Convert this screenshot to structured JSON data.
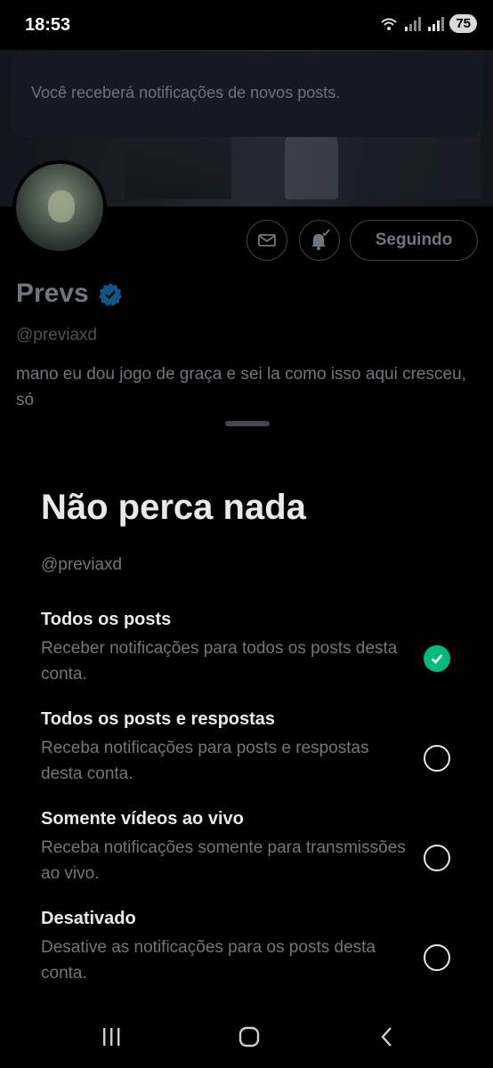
{
  "status_bar": {
    "time": "18:53",
    "battery": "75"
  },
  "toast": {
    "message": "Você receberá notificações de novos posts."
  },
  "profile": {
    "name": "Prevs",
    "handle": "@previaxd",
    "bio": "mano eu dou jogo de graça e sei la como isso aqui cresceu, só",
    "following_label": "Seguindo",
    "verified_color": "#1d9bf0"
  },
  "sheet": {
    "title": "Não perca nada",
    "handle": "@previaxd",
    "options": [
      {
        "title": "Todos os posts",
        "description": "Receber notificações para todos os posts desta conta.",
        "selected": true
      },
      {
        "title": "Todos os posts e respostas",
        "description": "Receba notificações para posts e respostas desta conta.",
        "selected": false
      },
      {
        "title": "Somente vídeos ao vivo",
        "description": "Receba notificações somente para transmissões ao vivo.",
        "selected": false
      },
      {
        "title": "Desativado",
        "description": "Desative as notificações para os posts desta conta.",
        "selected": false
      }
    ]
  },
  "colors": {
    "accent_green": "#00ba7c",
    "background": "#000000",
    "text_primary": "#e7e9ea",
    "text_secondary": "#71767b"
  },
  "nav": {
    "icons": [
      "recent-apps-icon",
      "home-icon",
      "back-icon"
    ]
  }
}
